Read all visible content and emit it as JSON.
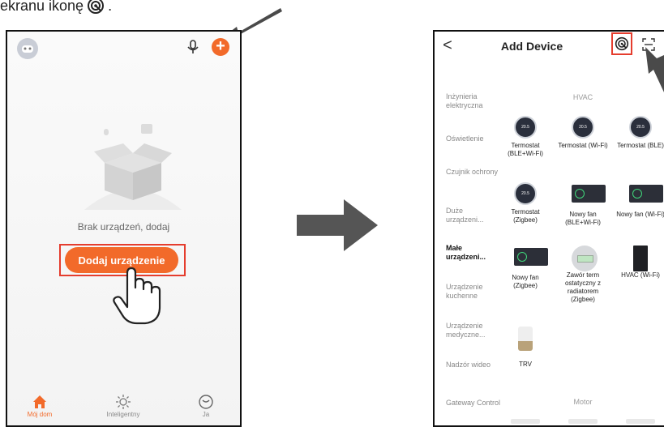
{
  "caption": {
    "text": "ekranu ikonę",
    "suffix": "."
  },
  "left_phone": {
    "empty_text": "Brak urządzeń, dodaj",
    "add_button_label": "Dodaj urządzenie",
    "plus_glyph": "+",
    "tabs": [
      {
        "label": "Mój dom",
        "icon": "home-icon",
        "active": true
      },
      {
        "label": "Inteligentny",
        "icon": "sun-icon",
        "active": false
      },
      {
        "label": "Ja",
        "icon": "profile-icon",
        "active": false
      }
    ]
  },
  "right_phone": {
    "back_glyph": "<",
    "title": "Add Device",
    "categories": [
      {
        "label": "Inżynieria elektryczna",
        "active": false
      },
      {
        "label": "Oświetlenie",
        "active": false
      },
      {
        "label": "Czujnik ochrony",
        "active": false
      },
      {
        "label": "Duże urządzeni...",
        "active": false
      },
      {
        "label": "Małe urządzeni...",
        "active": true
      },
      {
        "label": "Urządzenie kuchenne",
        "active": false
      },
      {
        "label": "Urządzenie medyczne...",
        "active": false
      },
      {
        "label": "Nadzór wideo",
        "active": false
      },
      {
        "label": "Gateway Control",
        "active": false
      }
    ],
    "sections": {
      "hvac": "HVAC",
      "motor": "Motor"
    },
    "thermostat_reading": "20.5",
    "devices": [
      {
        "name": "Termostat (BLE+Wi-Fi)",
        "kind": "thermostat"
      },
      {
        "name": "Termostat (Wi-Fi)",
        "kind": "thermostat"
      },
      {
        "name": "Termostat (BLE)",
        "kind": "thermostat"
      },
      {
        "name": "Termostat (Zigbee)",
        "kind": "thermostat"
      },
      {
        "name": "Nowy fan (BLE+Wi-Fi)",
        "kind": "fan-panel"
      },
      {
        "name": "Nowy fan (Wi-Fi)",
        "kind": "fan-panel"
      },
      {
        "name": "Nowy fan (Zigbee)",
        "kind": "fan-panel"
      },
      {
        "name": "Zawór term ostatyczny z radiatorem (Zigbee)",
        "kind": "valve"
      },
      {
        "name": "HVAC (Wi-Fi)",
        "kind": "hvac-box"
      },
      {
        "name": "TRV",
        "kind": "trv"
      }
    ]
  },
  "colors": {
    "accent": "#f26a2a",
    "highlight": "#e53d2e",
    "arrow": "#555555"
  }
}
